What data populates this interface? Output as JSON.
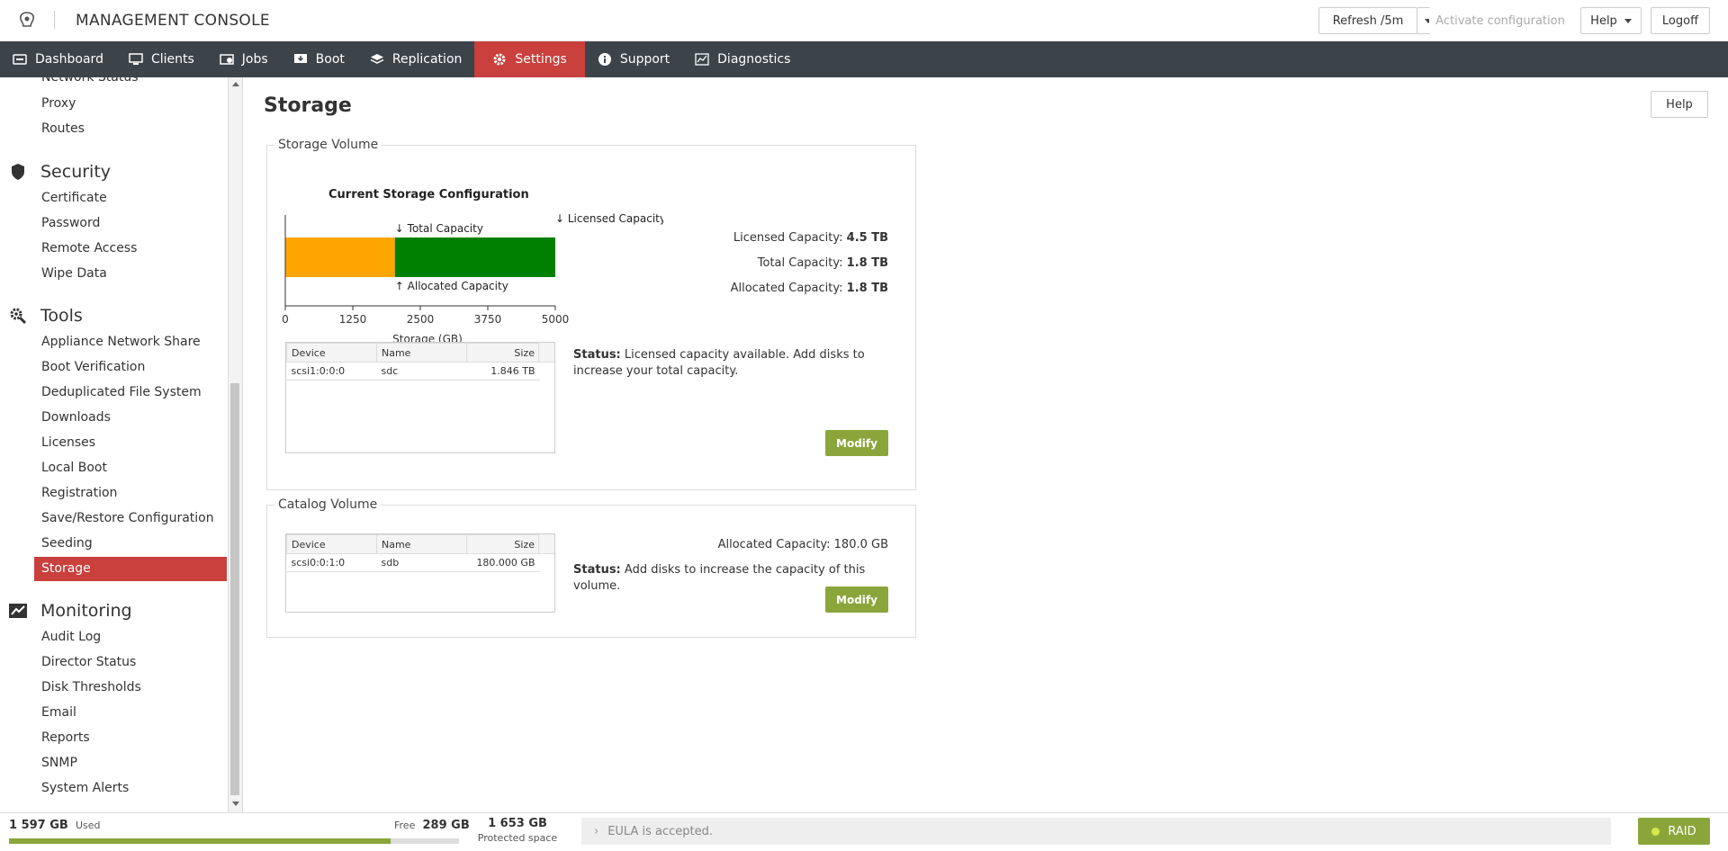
{
  "header": {
    "title": "MANAGEMENT CONSOLE",
    "refresh_label": "Refresh /5m",
    "activate_label": "Activate configuration",
    "help_label": "Help",
    "logoff_label": "Logoff"
  },
  "nav": {
    "items": [
      {
        "label": "Dashboard",
        "icon": "dashboard-icon"
      },
      {
        "label": "Clients",
        "icon": "monitor-icon"
      },
      {
        "label": "Jobs",
        "icon": "jobs-icon"
      },
      {
        "label": "Boot",
        "icon": "boot-icon"
      },
      {
        "label": "Replication",
        "icon": "layers-icon"
      },
      {
        "label": "Settings",
        "icon": "gear-icon"
      },
      {
        "label": "Support",
        "icon": "info-icon"
      },
      {
        "label": "Diagnostics",
        "icon": "diagnostics-icon"
      }
    ],
    "active": "Settings"
  },
  "sidebar": {
    "network_items": [
      "Network Status",
      "Proxy",
      "Routes"
    ],
    "security_title": "Security",
    "security_items": [
      "Certificate",
      "Password",
      "Remote Access",
      "Wipe Data"
    ],
    "tools_title": "Tools",
    "tools_items": [
      "Appliance Network Share",
      "Boot Verification",
      "Deduplicated File System",
      "Downloads",
      "Licenses",
      "Local Boot",
      "Registration",
      "Save/Restore Configuration",
      "Seeding",
      "Storage"
    ],
    "monitoring_title": "Monitoring",
    "monitoring_items": [
      "Audit Log",
      "Director Status",
      "Disk Thresholds",
      "Email",
      "Reports",
      "SNMP",
      "System Alerts"
    ],
    "active": "Storage"
  },
  "main": {
    "title": "Storage",
    "help_label": "Help",
    "storage_volume": {
      "legend": "Storage Volume",
      "chart_title": "Current Storage Configuration",
      "licensed_label": "Licensed Capacity:",
      "licensed_value": "4.5 TB",
      "total_label": "Total Capacity:",
      "total_value": "1.8 TB",
      "allocated_label": "Allocated Capacity:",
      "allocated_value": "1.8 TB",
      "table_headers": [
        "Device",
        "Name",
        "Size"
      ],
      "table_rows": [
        [
          "scsi1:0:0:0",
          "sdc",
          "1.846 TB"
        ]
      ],
      "status_label": "Status:",
      "status_text": "Licensed capacity available. Add disks to increase your total capacity.",
      "modify_label": "Modify"
    },
    "catalog_volume": {
      "legend": "Catalog Volume",
      "allocated_label": "Allocated Capacity:",
      "allocated_value": "180.0 GB",
      "table_headers": [
        "Device",
        "Name",
        "Size"
      ],
      "table_rows": [
        [
          "scsi0:0:1:0",
          "sdb",
          "180.000 GB"
        ]
      ],
      "status_label": "Status:",
      "status_text": "Add disks to increase the capacity of this volume.",
      "modify_label": "Modify"
    }
  },
  "chart_data": {
    "type": "bar",
    "orientation": "horizontal",
    "xlabel": "Storage (GB)",
    "xlim": [
      0,
      5000
    ],
    "ticks": [
      0,
      1250,
      2500,
      3750,
      5000
    ],
    "series": [
      {
        "name": "Allocated Capacity",
        "start": 0,
        "end": 2030,
        "color": "#ffa500"
      },
      {
        "name": "Total Capacity",
        "start": 2030,
        "end": 5000,
        "color": "#008000"
      }
    ],
    "markers": [
      {
        "label": "Total Capacity",
        "value": 2030,
        "position": "top",
        "arrow": "↓"
      },
      {
        "label": "Allocated Capacity",
        "value": 2030,
        "position": "bottom",
        "arrow": "↑"
      },
      {
        "label": "Licensed Capacity",
        "value": 5000,
        "position": "top",
        "arrow": "↓"
      }
    ]
  },
  "footer": {
    "used_value": "1 597 GB",
    "used_label": "Used",
    "free_label": "Free",
    "free_value": "289 GB",
    "used_fraction": 0.847,
    "protected_value": "1 653 GB",
    "protected_label": "Protected space",
    "eula_text": "EULA is accepted.",
    "raid_label": "RAID"
  },
  "colors": {
    "accent": "#c9403d",
    "nav_bg": "#3d4449",
    "button_green": "#8aa63a",
    "allocated_bar": "#ffa500",
    "total_bar": "#008000"
  }
}
